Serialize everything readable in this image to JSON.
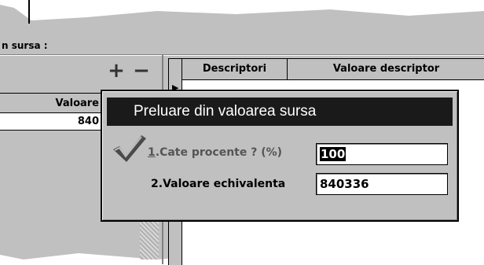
{
  "background": {
    "source_label": "n sursa  :",
    "buttons": {
      "plus": "+",
      "minus": "−"
    },
    "right_grid": {
      "columns": [
        "Descriptori",
        "Valoare descriptor"
      ]
    },
    "left_grid": {
      "header": "Valoare",
      "value": "840"
    }
  },
  "dialog": {
    "title": "Preluare din valoarea sursa",
    "fields": [
      {
        "accel": "1",
        "label": ".Cate procente ? (%)",
        "value": "100"
      },
      {
        "accel": "2",
        "label": ".Valoare echivalenta",
        "value": "840336"
      }
    ]
  },
  "colors": {
    "title_bar": "#1a1a1a",
    "face": "#c0c0c0",
    "check_gray": "#808080"
  }
}
